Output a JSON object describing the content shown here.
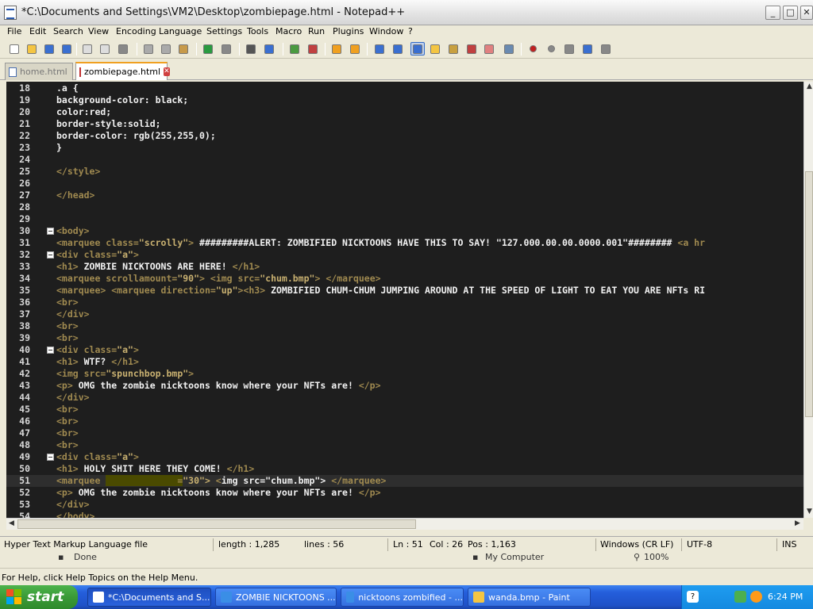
{
  "window": {
    "title": "*C:\\Documents and Settings\\VM2\\Desktop\\zombiepage.html - Notepad++",
    "min": "_",
    "max": "□",
    "close": "✕"
  },
  "menu": [
    "File",
    "Edit",
    "Search",
    "View",
    "Encoding",
    "Language",
    "Settings",
    "Tools",
    "Macro",
    "Run",
    "Plugins",
    "Window",
    "?"
  ],
  "tabs": [
    {
      "label": "home.html"
    },
    {
      "label": "zombiepage.html"
    }
  ],
  "editor": {
    "lines": [
      {
        "n": "18",
        "text": ".a {",
        "fold": false
      },
      {
        "n": "19",
        "text": "background-color: black;",
        "fold": false
      },
      {
        "n": "20",
        "text": "color:red;",
        "fold": false
      },
      {
        "n": "21",
        "text": "border-style:solid;",
        "fold": false
      },
      {
        "n": "22",
        "text": "border-color: rgb(255,255,0);",
        "fold": false
      },
      {
        "n": "23",
        "text": "}",
        "fold": false
      },
      {
        "n": "24",
        "text": "",
        "fold": false
      },
      {
        "n": "25",
        "text": "</style>",
        "fold": false
      },
      {
        "n": "26",
        "text": "",
        "fold": false
      },
      {
        "n": "27",
        "text": "</head>",
        "fold": false
      },
      {
        "n": "28",
        "text": "",
        "fold": false
      },
      {
        "n": "29",
        "text": "",
        "fold": false
      },
      {
        "n": "30",
        "text": "<body>",
        "fold": true
      },
      {
        "n": "31",
        "text": "<marquee class=\"scrolly\"> #########ALERT: ZOMBIFIED NICKTOONS HAVE THIS TO SAY! \"127.000.00.00.0000.001\"######## <a hr",
        "fold": false
      },
      {
        "n": "32",
        "text": "<div class=\"a\">",
        "fold": true
      },
      {
        "n": "33",
        "text": "<h1> ZOMBIE NICKTOONS ARE HERE! </h1>",
        "fold": false
      },
      {
        "n": "34",
        "text": "<marquee scrollamount=\"90\"> <img src=\"chum.bmp\"> </marquee>",
        "fold": false
      },
      {
        "n": "35",
        "text": "<marquee> <marquee direction=\"up\"><h3> ZOMBIFIED CHUM-CHUM JUMPING AROUND AT THE SPEED OF LIGHT TO EAT YOU ARE NFTs RI",
        "fold": false
      },
      {
        "n": "36",
        "text": "<br>",
        "fold": false
      },
      {
        "n": "37",
        "text": "</div>",
        "fold": false
      },
      {
        "n": "38",
        "text": "<br>",
        "fold": false
      },
      {
        "n": "39",
        "text": "<br>",
        "fold": false
      },
      {
        "n": "40",
        "text": "<div class=\"a\">",
        "fold": true
      },
      {
        "n": "41",
        "text": "<h1> WTF? </h1>",
        "fold": false
      },
      {
        "n": "42",
        "text": "<img src=\"spunchbop.bmp\">",
        "fold": false
      },
      {
        "n": "43",
        "text": "<p> OMG the zombie nicktoons know where your NFTs are! </p>",
        "fold": false
      },
      {
        "n": "44",
        "text": "</div>",
        "fold": false
      },
      {
        "n": "45",
        "text": "<br>",
        "fold": false
      },
      {
        "n": "46",
        "text": "<br>",
        "fold": false
      },
      {
        "n": "47",
        "text": "<br>",
        "fold": false
      },
      {
        "n": "48",
        "text": "<br>",
        "fold": false
      },
      {
        "n": "49",
        "text": "<div class=\"a\">",
        "fold": true
      },
      {
        "n": "50",
        "text": "<h1> HOLY SHIT HERE THEY COME! </h1>",
        "fold": false
      },
      {
        "n": "51",
        "text": "<marquee              =\"30\"> <img src=\"chum.bmp\"> </marquee>",
        "fold": false,
        "current": true
      },
      {
        "n": "52",
        "text": "<p> OMG the zombie nicktoons know where your NFTs are! </p>",
        "fold": false
      },
      {
        "n": "53",
        "text": "</div>",
        "fold": false
      },
      {
        "n": "54",
        "text": "</body>",
        "fold": false
      }
    ]
  },
  "status": {
    "filetype": "Hyper Text Markup Language file",
    "length": "length : 1,285",
    "lines": "lines : 56",
    "ln": "Ln : 51",
    "col": "Col : 26",
    "pos": "Pos : 1,163",
    "eol": "Windows (CR LF)",
    "encoding": "UTF-8",
    "mode": "INS"
  },
  "background_window": {
    "done": "Done",
    "zone": "My Computer",
    "zoom": "100%"
  },
  "help_text": "For Help, click Help Topics on the Help Menu.",
  "taskbar": {
    "start": "start",
    "tasks": [
      {
        "label": "*C:\\Documents and S...",
        "icon": "notepadpp-icon"
      },
      {
        "label": "ZOMBIE NICKTOONS ...",
        "icon": "ie-icon"
      },
      {
        "label": "nicktoons zombified - ...",
        "icon": "ie-icon"
      },
      {
        "label": "wanda.bmp - Paint",
        "icon": "paint-icon"
      }
    ],
    "clock": "6:24 PM"
  },
  "colors": {
    "editor_bg": "#1e1e1e",
    "tag": "#a08a50",
    "string": "#c8b070",
    "text": "#f2f2f2",
    "taskbar": "#245edb",
    "start": "#3a9a37"
  }
}
